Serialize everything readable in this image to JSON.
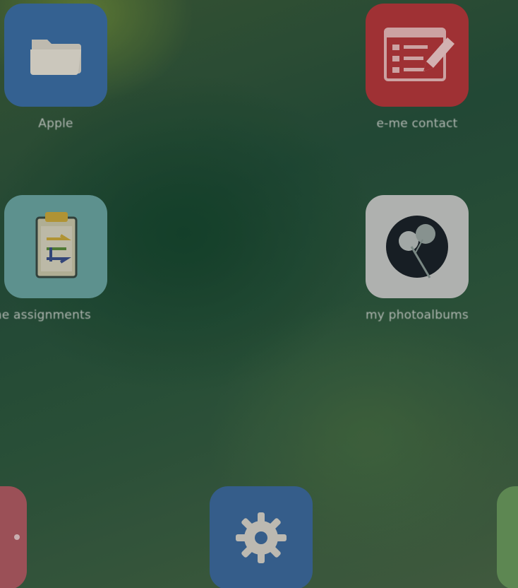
{
  "home_screen": {
    "apps": [
      {
        "label": "Apple",
        "icon": "folder-icon",
        "color": "#3c6fa6"
      },
      {
        "label": "e-me contact",
        "icon": "notepad-pencil-icon",
        "color": "#b6383c"
      },
      {
        "label": "e-me assignments",
        "icon": "clipboard-icon",
        "color": "#6aa5a2"
      },
      {
        "label": "my photoalbums",
        "icon": "dandelion-icon",
        "color": "#c8cac8"
      }
    ],
    "dock": [
      {
        "icon": "app-icon-partial-left",
        "color": "#b15c63"
      },
      {
        "icon": "settings-gear-icon",
        "color": "#3d6a9e"
      },
      {
        "icon": "app-icon-partial-right",
        "color": "#6a9a5e"
      }
    ]
  }
}
